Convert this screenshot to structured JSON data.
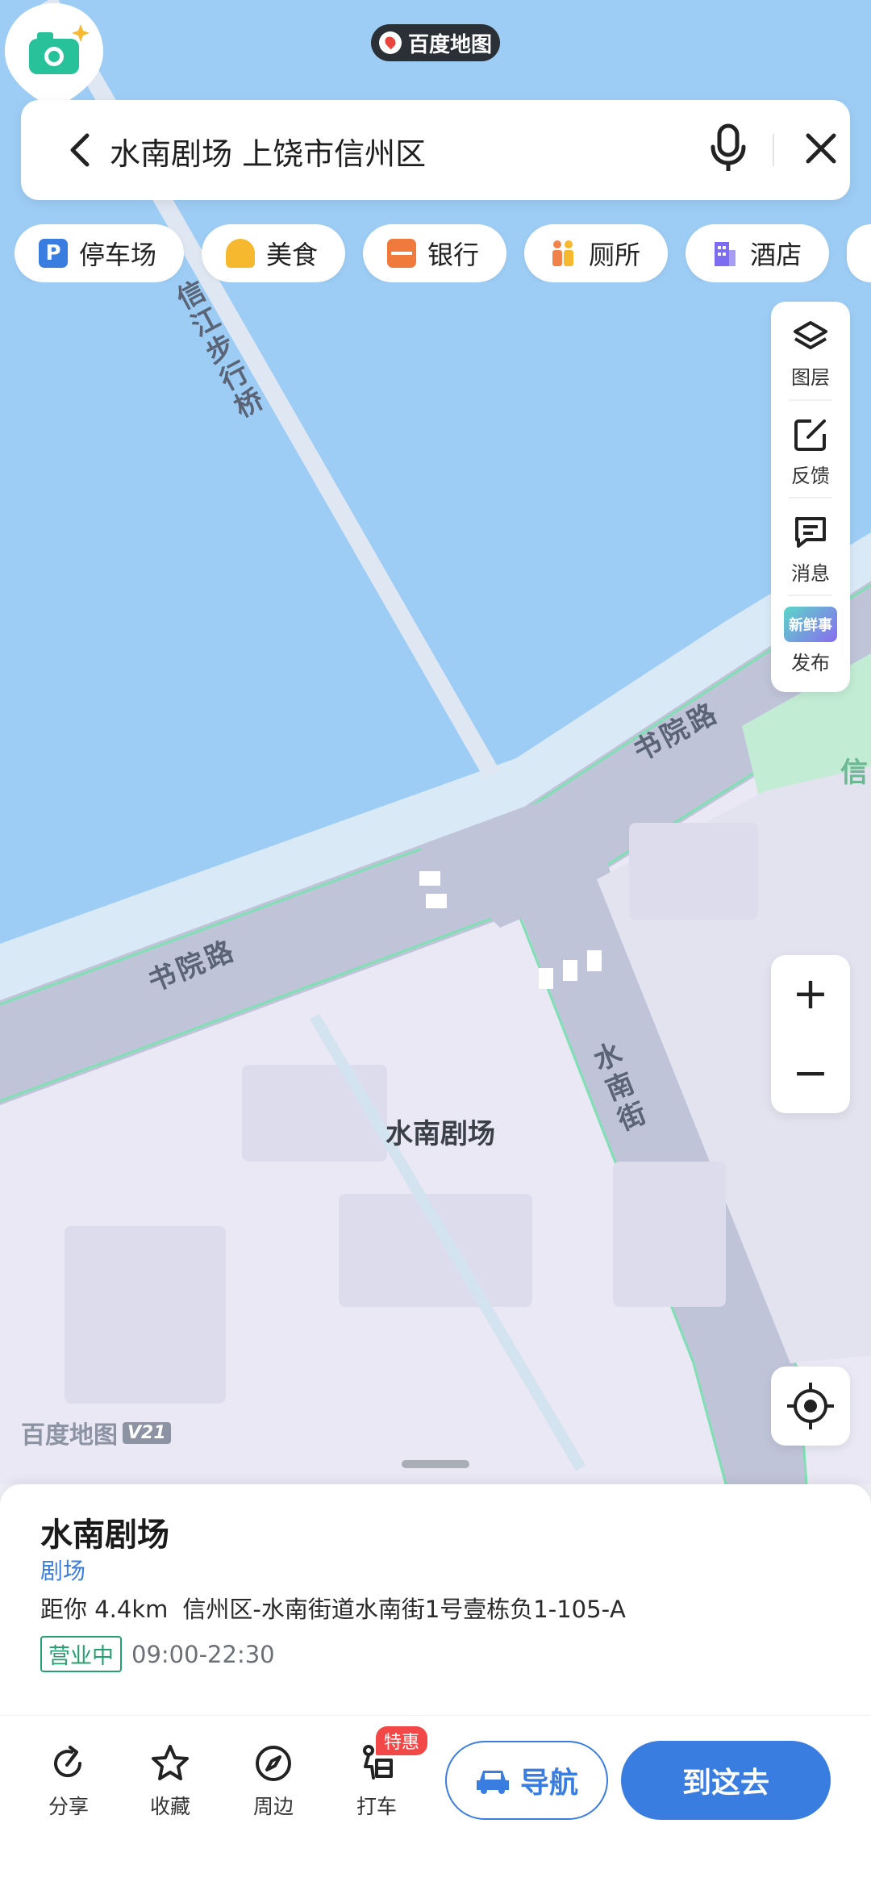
{
  "app_badge": {
    "label": "百度地图"
  },
  "search": {
    "query": "水南剧场 上饶市信州区"
  },
  "chips": [
    {
      "label": "停车场",
      "icon": "parking-icon",
      "color": "#3a7de0"
    },
    {
      "label": "美食",
      "icon": "food-icon",
      "color": "#f5a623"
    },
    {
      "label": "银行",
      "icon": "bank-card-icon",
      "color": "#f07a3c"
    },
    {
      "label": "厕所",
      "icon": "toilet-icon",
      "color": "#f0834a"
    },
    {
      "label": "酒店",
      "icon": "hotel-icon",
      "color": "#7b6cf0"
    }
  ],
  "tools": {
    "layers": "图层",
    "feedback": "反馈",
    "messages": "消息",
    "publish": "发布",
    "publish_badge": "新鲜事"
  },
  "zoom": {
    "in": "+",
    "out": "−"
  },
  "map": {
    "bridge_label": "信江步行桥",
    "road_shuyuan_upper": "书院路",
    "road_shuyuan_lower": "书院路",
    "road_shuinan": "水南街",
    "edge_label": "信",
    "poi_label": "水南剧场"
  },
  "watermark": {
    "brand": "百度地图",
    "version": "V21"
  },
  "place": {
    "name": "水南剧场",
    "category": "剧场",
    "distance": "距你 4.4km",
    "address": "信州区-水南街道水南街1号壹栋负1-105-A",
    "status": "营业中",
    "hours": "09:00-22:30"
  },
  "actions": {
    "share": "分享",
    "favorite": "收藏",
    "nearby": "周边",
    "taxi": "打车",
    "promo": "特惠",
    "navigate": "导航",
    "go_here": "到这去"
  },
  "colors": {
    "water": "#9dcdf5",
    "road": "#bfc4d8",
    "block": "#e7e6f3",
    "green": "#c2ecd4",
    "accent": "#3a7de0"
  }
}
